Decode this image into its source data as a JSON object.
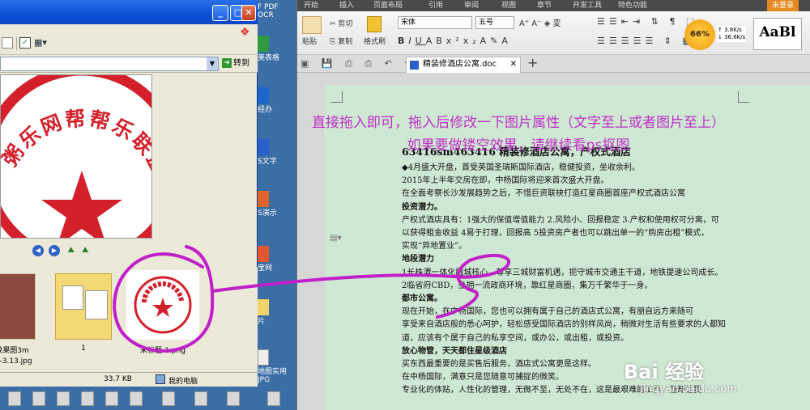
{
  "viewer": {
    "address_goto_label": "转到",
    "thumbnails": [
      {
        "label": "效果图3m宽-3.13.jpg"
      },
      {
        "label": "1"
      },
      {
        "label": "未标题-1.png"
      }
    ],
    "status": {
      "size": "33.7 KB",
      "location": "我的电脑"
    },
    "stamp_text": "粥乐网帮帮乐联盟"
  },
  "desktop_icons": [
    {
      "label": "F PDF OCR"
    },
    {
      "label": "美表格"
    },
    {
      "label": "经办"
    },
    {
      "label": "S文字"
    },
    {
      "label": "S演示"
    },
    {
      "label": "宝网"
    },
    {
      "label": "片"
    },
    {
      "label": "地图实用"
    },
    {
      "label": "JPG"
    }
  ],
  "wps": {
    "menu": [
      "开始",
      "插入",
      "页面布局",
      "引用",
      "审阅",
      "视图",
      "章节",
      "开发工具",
      "特色功能",
      "未登录"
    ],
    "ribbon": {
      "paste": "粘贴",
      "cut": "剪切",
      "copy": "复制",
      "format_painter": "格式刷",
      "font_name": "宋体",
      "font_size": "五号"
    },
    "doc_tab": "精装修酒店公寓.doc",
    "new_tab": "+"
  },
  "speed_widget": {
    "percent": "66%",
    "up": "3.8K/s",
    "down": "36.6K/s"
  },
  "style_preview": "AaBl",
  "annotation": {
    "line1": "直接拖入即可，拖入后修改一下图片属性（文字至上或者图片至上）",
    "line2": "如果要做镂空效果，请继续看ps抠图"
  },
  "document": {
    "title": "63416sm463416 精装修酒店公寓，产权式酒店",
    "lines": [
      {
        "text": "◆4月盛大开盘，首受英国圣瑞斯国际酒店，稳健投资，坐收余利。",
        "bold": false
      },
      {
        "text": "2015年上半年交房在即，中杨国际将迎来首次盛大开盘。",
        "bold": false
      },
      {
        "text": "在全面考察长沙发展趋势之后，不惜巨资联袂打造红星商圈首座产权式酒店公寓",
        "bold": false
      },
      {
        "text": "投资潜力。",
        "bold": true
      },
      {
        "text": "产权式酒店具有：1强大的保值增值能力 2.风险小、回报稳定 3.产权和使用权可分离，可",
        "bold": false
      },
      {
        "text": "以获得租金收益 4易于打理，回报高 5投资房产者也可以跳出单一的“购房出租”模式，",
        "bold": false
      },
      {
        "text": "实现“异地置业”。",
        "bold": false
      },
      {
        "text": "地段潜力",
        "bold": true
      },
      {
        "text": "1长株潭一体化融城核心，尊享三城财富机遇，扼守城市交通主干道，地铁提速公司成长。",
        "bold": false
      },
      {
        "text": "2临省府CBD，坐拥一流政商环境，靠红星商圈，集万千繁华于一身。",
        "bold": false
      },
      {
        "text": "都市公寓。",
        "bold": true
      },
      {
        "text": "现在开始，在中杨国际，您也可以拥有属于自己的酒店式公寓，有朋自远方来随可",
        "bold": false
      },
      {
        "text": "享受来自酒店般的悉心呵护，轻松感受国际酒店的别样风尚，稍微对生活有些要求的人都知",
        "bold": false
      },
      {
        "text": "道，应该有个属于自己的私享空间，或办公，或出租，或投资。",
        "bold": false
      },
      {
        "text": "放心物管，天天都住星级酒店",
        "bold": true
      },
      {
        "text": "买东西最重要的是买售后服务，酒店式公寓更是这样。",
        "bold": false
      },
      {
        "text": "在中杨国际，满意只是您随意可捕捉的微笑。",
        "bold": false
      },
      {
        "text": "专业化的体贴，人性化的管理，无微不至，无处不在，这是最艰难的工作，但却让我",
        "bold": false
      }
    ]
  },
  "watermark": {
    "brand": "Bai 经验",
    "url": "jingyan.baidu.com"
  }
}
